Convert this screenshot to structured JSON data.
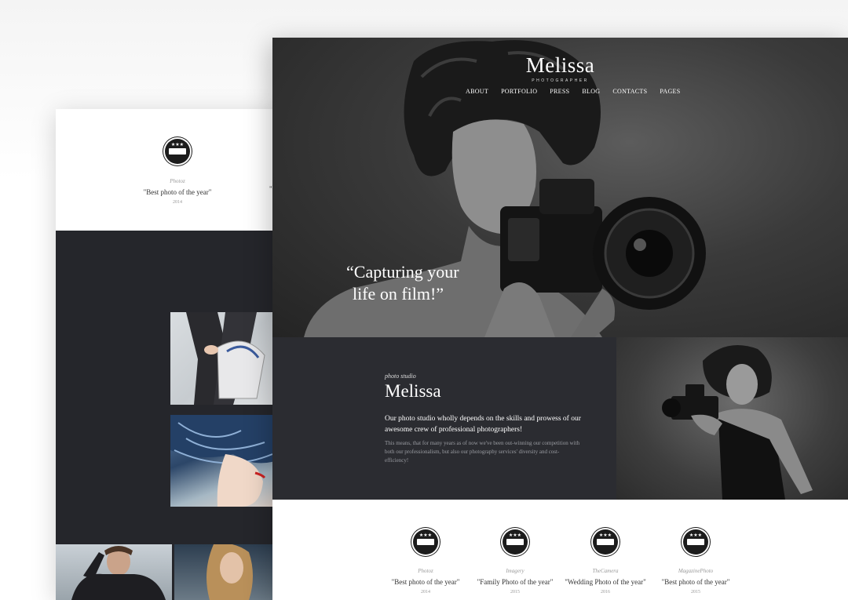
{
  "back_page": {
    "award": {
      "source": "Photoz",
      "title": "\"Best photo of the year\"",
      "year": "2014"
    },
    "award_peek": "\""
  },
  "site": {
    "logo": "Melissa",
    "logo_sub": "PHOTOGRAPHER",
    "nav": [
      "ABOUT",
      "PORTFOLIO",
      "PRESS",
      "BLOG",
      "CONTACTS",
      "PAGES"
    ],
    "hero_quote_line1": "“Capturing your",
    "hero_quote_line2": "life on film!”"
  },
  "about": {
    "tag": "photo studio",
    "title": "Melissa",
    "lead": "Our photo studio wholly depends on the skills and prowess of our awesome crew of professional photographers!",
    "body": "This means, that for many years as of now we've been out-winning our competition with both our professionalism, but also our photography services' diversity and cost-efficiency!"
  },
  "awards": [
    {
      "source": "Photoz",
      "title": "\"Best photo of the year\"",
      "year": "2014"
    },
    {
      "source": "Imagery",
      "title": "\"Family Photo of the year\"",
      "year": "2015"
    },
    {
      "source": "TheCamera",
      "title": "\"Wedding Photo of the year\"",
      "year": "2016"
    },
    {
      "source": "MagazinePhoto",
      "title": "\"Best photo of the year\"",
      "year": "2015"
    }
  ],
  "colors": {
    "dark_panel": "#2b2c31",
    "back_dark": "#25262b",
    "badge": "#1c1c1c",
    "accent_text": "#ffffff"
  }
}
